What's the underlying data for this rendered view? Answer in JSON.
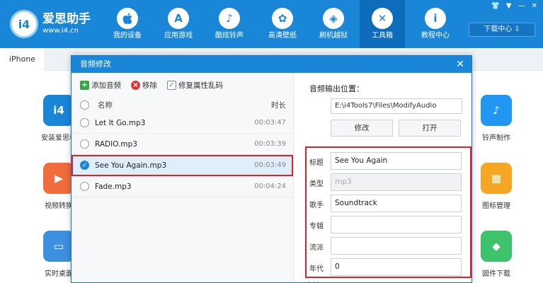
{
  "app": {
    "title": "爱思助手",
    "url": "www.i4.cn",
    "logo_glyph": "i4"
  },
  "nav": [
    {
      "label": "我的设备",
      "icon": "apple-icon",
      "glyph": ""
    },
    {
      "label": "应用游戏",
      "icon": "app-store-icon",
      "glyph": "A"
    },
    {
      "label": "酷炫铃声",
      "icon": "bell-icon",
      "glyph": "♪"
    },
    {
      "label": "高清壁纸",
      "icon": "flower-icon",
      "glyph": "✿"
    },
    {
      "label": "刷机越狱",
      "icon": "box-icon",
      "glyph": "◈"
    },
    {
      "label": "工具箱",
      "icon": "tools-icon",
      "glyph": "✕"
    },
    {
      "label": "教程中心",
      "icon": "info-icon",
      "glyph": "i"
    }
  ],
  "window_controls": [
    "👕",
    "▼",
    "—",
    "✕"
  ],
  "download_center": "下载中心 ⇩",
  "device_tab": "iPhone",
  "tools_left": [
    {
      "label": "安装爱思移",
      "color": "#1a86d8",
      "glyph": "i4"
    },
    {
      "label": "视频转换",
      "color": "#f26b3a",
      "glyph": "▶"
    },
    {
      "label": "实时桌面",
      "color": "#3d8fe0",
      "glyph": "▭"
    }
  ],
  "tools_right": [
    {
      "label": "铃声制作",
      "color": "#2196f3",
      "glyph": "♪"
    },
    {
      "label": "图标管理",
      "color": "#f5a623",
      "glyph": "▦"
    },
    {
      "label": "固件下载",
      "color": "#3cc36b",
      "glyph": "◆"
    }
  ],
  "dialog": {
    "title": "音频修改",
    "close": "✕",
    "toolbar": {
      "add": "添加音频",
      "remove": "移除",
      "repair": "修复属性乱码"
    },
    "columns": {
      "name": "名称",
      "duration": "时长"
    },
    "files": [
      {
        "name": "Let It Go.mp3",
        "duration": "00:03:47"
      },
      {
        "name": "RADIO.mp3",
        "duration": "00:03:39"
      },
      {
        "name": "See You Again.mp3",
        "duration": "00:03:49"
      },
      {
        "name": "Fade.mp3",
        "duration": "00:04:24"
      }
    ],
    "selected_index": 2,
    "output_label": "音频输出位置：",
    "output_path": "E:\\i4Tools7\\Files\\ModifyAudio",
    "modify_button": "修改",
    "open_button": "打开",
    "meta": [
      {
        "label": "标题",
        "value": "See You Again",
        "disabled": false
      },
      {
        "label": "类型",
        "value": "mp3",
        "disabled": true
      },
      {
        "label": "歌手",
        "value": "Soundtrack",
        "disabled": false
      },
      {
        "label": "专辑",
        "value": "",
        "disabled": false
      },
      {
        "label": "流派",
        "value": "",
        "disabled": false
      },
      {
        "label": "年代",
        "value": "0",
        "disabled": false
      }
    ],
    "below_label": "备注"
  },
  "colors": {
    "brand": "#1a86d8",
    "highlight": "#d9262a"
  }
}
